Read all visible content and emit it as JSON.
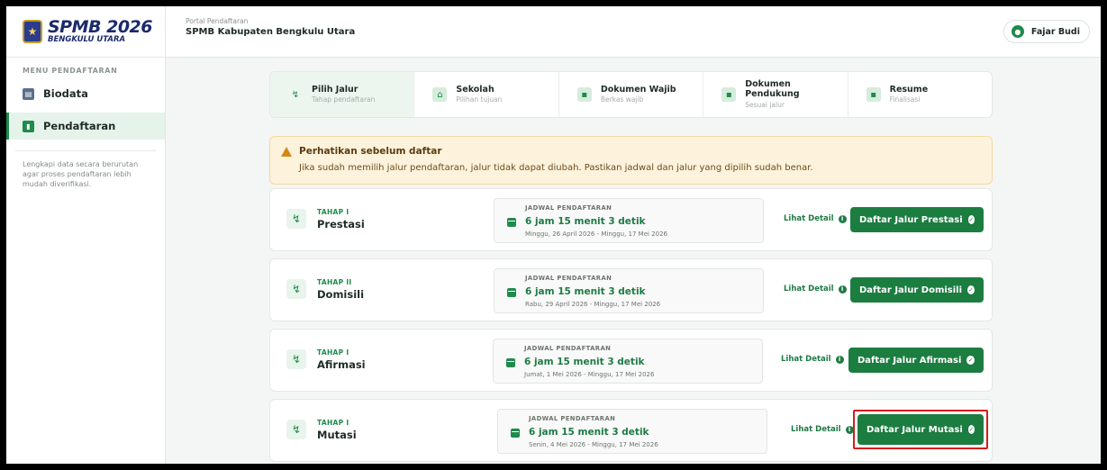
{
  "brand": {
    "title": "SPMB 2026",
    "subtitle": "BENGKULU UTARA"
  },
  "header": {
    "small": "Portal Pendaftaran",
    "title": "SPMB Kabupaten Bengkulu Utara",
    "user": "Fajar Budi"
  },
  "sidebar": {
    "menu_title": "MENU PENDAFTARAN",
    "items": [
      {
        "label": "Biodata",
        "icon": "id-card-icon"
      },
      {
        "label": "Pendaftaran",
        "icon": "clipboard-icon"
      }
    ],
    "hint": "Lengkapi data secara berurutan agar proses pendaftaran lebih mudah diverifikasi."
  },
  "steps": [
    {
      "label": "Pilih Jalur",
      "sub": "Tahap pendaftaran"
    },
    {
      "label": "Sekolah",
      "sub": "Pilihan tujuan"
    },
    {
      "label": "Dokumen Wajib",
      "sub": "Berkas wajib"
    },
    {
      "label": "Dokumen Pendukung",
      "sub": "Sesuai jalur"
    },
    {
      "label": "Resume",
      "sub": "Finalisasi"
    }
  ],
  "alert": {
    "title": "Perhatikan sebelum daftar",
    "text": "Jika sudah memilih jalur pendaftaran, jalur tidak dapat diubah. Pastikan jadwal dan jalur yang dipilih sudah benar."
  },
  "cards": [
    {
      "tahap": "TAHAP I",
      "name": "Prestasi",
      "jadwal_label": "JADWAL PENDAFTARAN",
      "countdown": "6 jam 15 menit 3 detik",
      "dates": "Minggu, 26 April 2026 - Minggu, 17 Mei 2026",
      "detail": "Lihat Detail",
      "button": "Daftar Jalur Prestasi"
    },
    {
      "tahap": "TAHAP II",
      "name": "Domisili",
      "jadwal_label": "JADWAL PENDAFTARAN",
      "countdown": "6 jam 15 menit 3 detik",
      "dates": "Rabu, 29 April 2026 - Minggu, 17 Mei 2026",
      "detail": "Lihat Detail",
      "button": "Daftar Jalur Domisili"
    },
    {
      "tahap": "TAHAP I",
      "name": "Afirmasi",
      "jadwal_label": "JADWAL PENDAFTARAN",
      "countdown": "6 jam 15 menit 3 detik",
      "dates": "Jumat, 1 Mei 2026 - Minggu, 17 Mei 2026",
      "detail": "Lihat Detail",
      "button": "Daftar Jalur Afirmasi"
    },
    {
      "tahap": "TAHAP I",
      "name": "Mutasi",
      "jadwal_label": "JADWAL PENDAFTARAN",
      "countdown": "6 jam 15 menit 3 detik",
      "dates": "Senin, 4 Mei 2026 - Minggu, 17 Mei 2026",
      "detail": "Lihat Detail",
      "button": "Daftar Jalur Mutasi"
    }
  ],
  "colors": {
    "primary": "#1c7d40",
    "highlight": "#d21d1d",
    "alert_bg": "#fdf3dc"
  }
}
